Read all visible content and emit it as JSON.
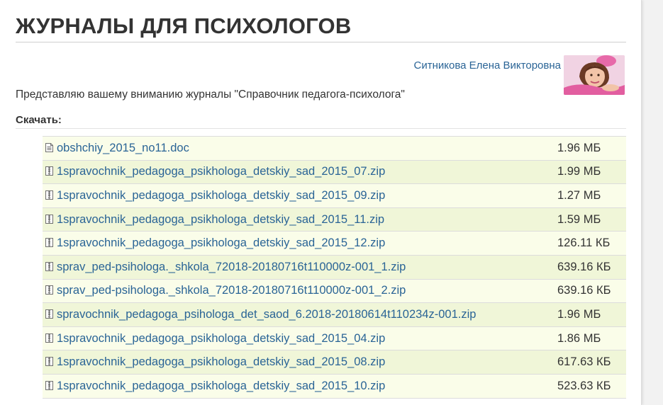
{
  "page": {
    "title": "ЖУРНАЛЫ ДЛЯ ПСИХОЛОГОВ",
    "author": "Ситникова Елена Викторовна",
    "intro": "Представляю вашему вниманию журналы \"Справочник педагога-психолога\"",
    "download_label": "Скачать:"
  },
  "files": [
    {
      "name": "obshchiy_2015_no11.doc",
      "size": "1.96 МБ",
      "icon": "document-icon"
    },
    {
      "name": "1spravochnik_pedagoga_psikhologa_detskiy_sad_2015_07.zip",
      "size": "1.99 МБ",
      "icon": "archive-icon"
    },
    {
      "name": "1spravochnik_pedagoga_psikhologa_detskiy_sad_2015_09.zip",
      "size": "1.27 МБ",
      "icon": "archive-icon"
    },
    {
      "name": "1spravochnik_pedagoga_psikhologa_detskiy_sad_2015_11.zip",
      "size": "1.59 МБ",
      "icon": "archive-icon"
    },
    {
      "name": "1spravochnik_pedagoga_psikhologa_detskiy_sad_2015_12.zip",
      "size": "126.11 КБ",
      "icon": "archive-icon"
    },
    {
      "name": "sprav_ped-psihologa._shkola_72018-20180716t110000z-001_1.zip",
      "size": "639.16 КБ",
      "icon": "archive-icon"
    },
    {
      "name": "sprav_ped-psihologa._shkola_72018-20180716t110000z-001_2.zip",
      "size": "639.16 КБ",
      "icon": "archive-icon"
    },
    {
      "name": "spravochnik_pedagoga_psihologa_det_saod_6.2018-20180614t110234z-001.zip",
      "size": "1.96 МБ",
      "icon": "archive-icon"
    },
    {
      "name": "1spravochnik_pedagoga_psikhologa_detskiy_sad_2015_04.zip",
      "size": "1.86 МБ",
      "icon": "archive-icon"
    },
    {
      "name": "1spravochnik_pedagoga_psikhologa_detskiy_sad_2015_08.zip",
      "size": "617.63 КБ",
      "icon": "archive-icon"
    },
    {
      "name": "1spravochnik_pedagoga_psikhologa_detskiy_sad_2015_10.zip",
      "size": "523.63 КБ",
      "icon": "archive-icon"
    }
  ],
  "colors": {
    "link": "#2a6496",
    "row_odd": "#fafde9",
    "row_even": "#f0f6d8",
    "text": "#333333"
  }
}
